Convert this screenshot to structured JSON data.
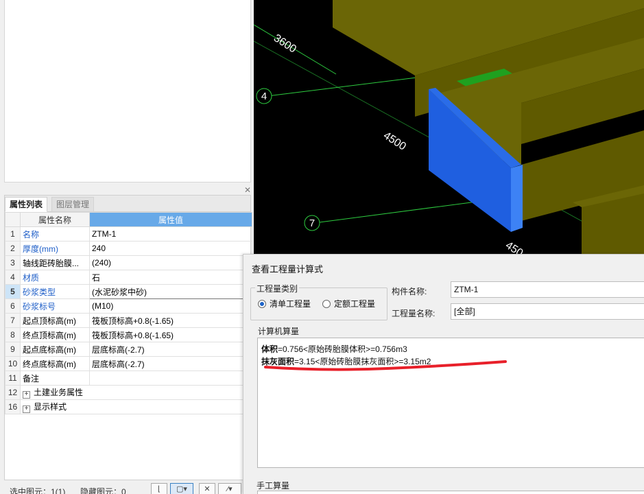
{
  "property_panel": {
    "tabs": [
      "属性列表",
      "图层管理"
    ],
    "columns": {
      "name": "属性名称",
      "value": "属性值"
    },
    "rows": [
      {
        "num": "1",
        "name": "名称",
        "value": "ZTM-1",
        "blue": true
      },
      {
        "num": "2",
        "name": "厚度(mm)",
        "value": "240",
        "blue": true
      },
      {
        "num": "3",
        "name": "轴线距砖胎膜...",
        "value": "(240)",
        "blue": false
      },
      {
        "num": "4",
        "name": "材质",
        "value": "石",
        "blue": true
      },
      {
        "num": "5",
        "name": "砂浆类型",
        "value": "(水泥砂浆中砂)",
        "blue": true
      },
      {
        "num": "6",
        "name": "砂浆标号",
        "value": "(M10)",
        "blue": true
      },
      {
        "num": "7",
        "name": "起点顶标高(m)",
        "value": "筏板顶标高+0.8(-1.65)",
        "blue": false
      },
      {
        "num": "8",
        "name": "终点顶标高(m)",
        "value": "筏板顶标高+0.8(-1.65)",
        "blue": false
      },
      {
        "num": "9",
        "name": "起点底标高(m)",
        "value": "层底标高(-2.7)",
        "blue": false
      },
      {
        "num": "10",
        "name": "终点底标高(m)",
        "value": "层底标高(-2.7)",
        "blue": false
      },
      {
        "num": "11",
        "name": "备注",
        "value": "",
        "blue": false
      },
      {
        "num": "12",
        "name": "土建业务属性",
        "value": "",
        "blue": false,
        "expander": "+"
      },
      {
        "num": "16",
        "name": "显示样式",
        "value": "",
        "blue": false,
        "expander": "+"
      }
    ],
    "selected_row": "5"
  },
  "status_bar": {
    "selected": "选中图元：1(1)",
    "hidden": "隐藏图元：0"
  },
  "viewport": {
    "axis_labels": [
      "4",
      "7"
    ],
    "dimensions": [
      "3600",
      "4500",
      "450"
    ],
    "colors": {
      "background": "#000000",
      "wall": "#5f5a00",
      "wall_top": "#6b6606",
      "brick_mold": "#1f5fe0",
      "slab": "#1fa01f",
      "grid": "#2ecc40"
    }
  },
  "dialog": {
    "title": "查看工程量计算式",
    "category_group": "工程量类别",
    "radio_list": "清单工程量",
    "radio_quota": "定额工程量",
    "component_label": "构件名称:",
    "component_value": "ZTM-1",
    "quantity_label": "工程量名称:",
    "quantity_value": "[全部]",
    "computer_group": "计算机算量",
    "line1_key": "体积",
    "line1_rest": "=0.756<原始砖胎膜体积>=0.756m3",
    "line2_key": "抹灰面积",
    "line2_rest": "=3.15<原始砖胎膜抹灰面积>=3.15m2",
    "manual_group": "手工算量",
    "annotation_color": "#e8202a"
  }
}
